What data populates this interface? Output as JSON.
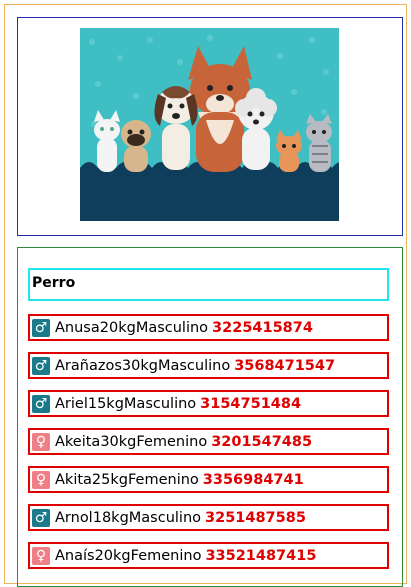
{
  "hero": {
    "illustration": "dogs-and-cats-group-illustration",
    "colors": {
      "background": "#3fbfc4",
      "ground": "#0f3d5c"
    }
  },
  "list": {
    "category": "Perro",
    "items": [
      {
        "name": "Anusa",
        "weight": "20kg",
        "sex": "Masculino",
        "phone": "3225415874",
        "icon": "male-icon"
      },
      {
        "name": "Arañazos",
        "weight": "30kg",
        "sex": "Masculino",
        "phone": "3568471547",
        "icon": "male-icon"
      },
      {
        "name": "Ariel",
        "weight": "15kg",
        "sex": "Masculino",
        "phone": "3154751484",
        "icon": "male-icon"
      },
      {
        "name": "Akeita",
        "weight": "30kg",
        "sex": "Femenino",
        "phone": "3201547485",
        "icon": "female-icon"
      },
      {
        "name": "Akita",
        "weight": "25kg",
        "sex": "Femenino",
        "phone": "3356984741",
        "icon": "female-icon"
      },
      {
        "name": "Arnol",
        "weight": "18kg",
        "sex": "Masculino",
        "phone": "3251487585",
        "icon": "male-icon"
      },
      {
        "name": "Anaís",
        "weight": "20kg",
        "sex": "Femenino",
        "phone": "33521487415",
        "icon": "female-icon"
      }
    ]
  },
  "colors": {
    "outer_border": "#f0b35a",
    "image_border": "#1f2fb0",
    "list_border": "#2e8b3a",
    "category_border": "#22e6ee",
    "row_border": "#e00000",
    "phone": "#e00000",
    "male_icon_bg": "#1b7a8a",
    "female_icon_bg": "#ef7f86"
  }
}
